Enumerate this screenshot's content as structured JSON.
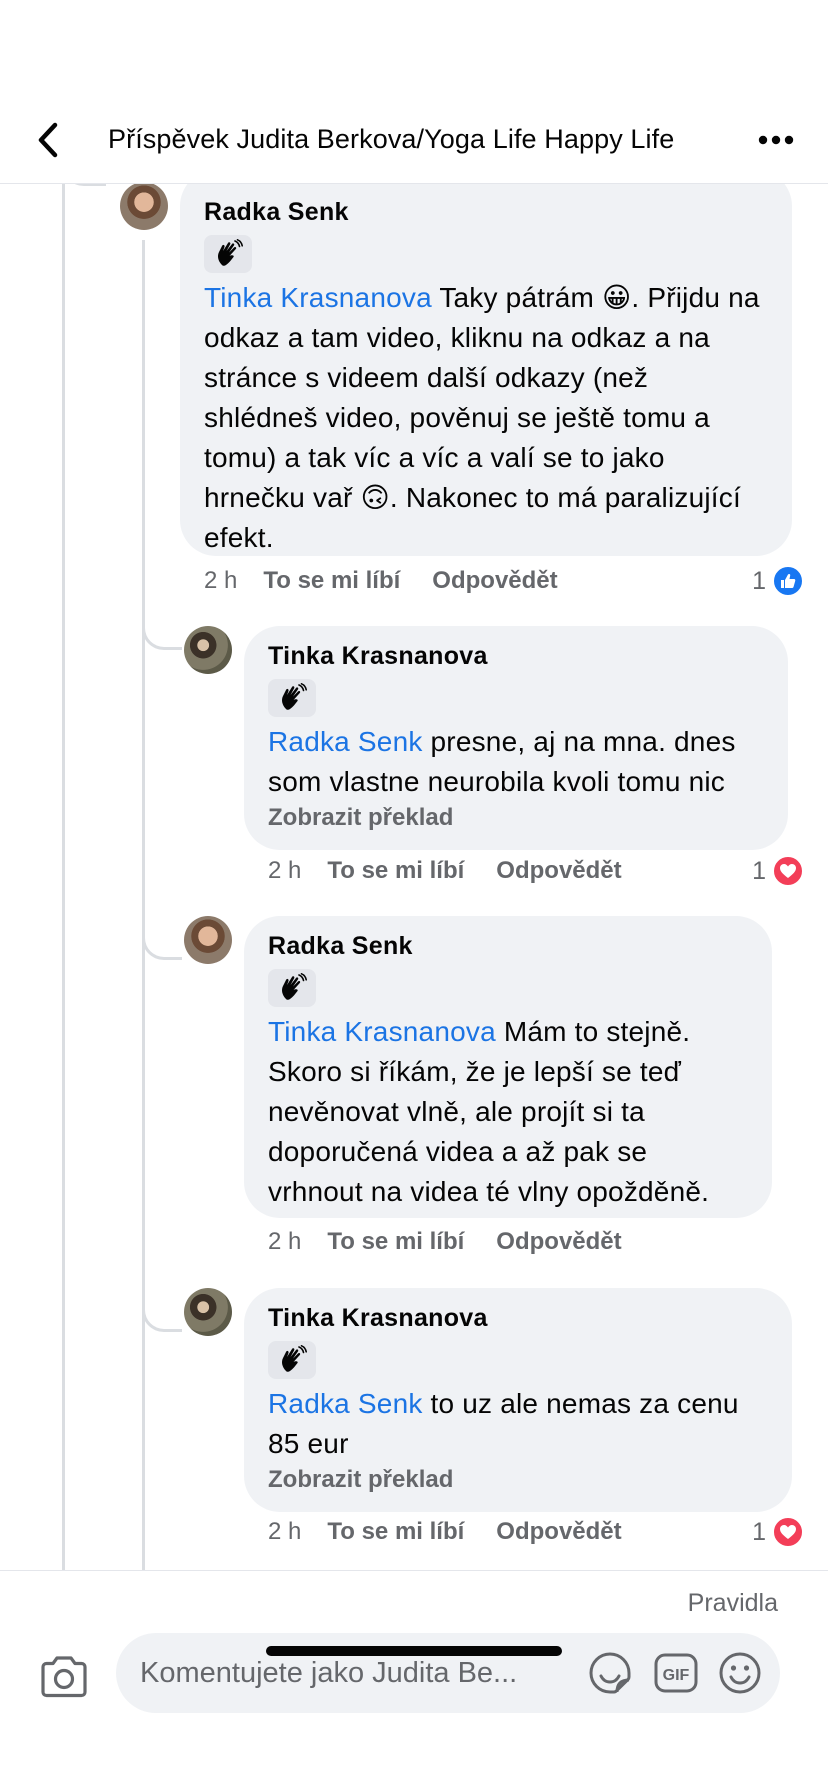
{
  "header": {
    "title": "Příspěvek Judita Berkova/Yoga Life Happy Life",
    "back_icon": "chevron-left-icon",
    "more_icon": "more-dots-icon"
  },
  "comments": [
    {
      "author": "Radka Senk",
      "badge_icon": "wave-hand-icon",
      "mention": "Tinka Krasnanova",
      "text": " Taky pátrám 😀. Přijdu na odkaz a tam video, kliknu na odkaz a na stránce s videem další odkazy (než shlédneš video, pověnuj se ještě tomu a tomu) a tak víc a víc a valí se to jako hrnečku vař 🙃. Nakonec to má paralizující efekt.",
      "time": "2 h",
      "like_label": "To se mi líbí",
      "reply_label": "Odpovědět",
      "reaction_count": "1",
      "reaction_type": "like"
    },
    {
      "author": "Tinka Krasnanova",
      "badge_icon": "wave-hand-icon",
      "mention": "Radka Senk",
      "text": " presne, aj na mna. dnes som vlastne neurobila kvoli tomu nic",
      "translate": "Zobrazit překlad",
      "time": "2 h",
      "like_label": "To se mi líbí",
      "reply_label": "Odpovědět",
      "reaction_count": "1",
      "reaction_type": "love"
    },
    {
      "author": "Radka Senk",
      "badge_icon": "wave-hand-icon",
      "mention": "Tinka Krasnanova",
      "text": " Mám to stejně. Skoro si říkám, že je lepší se teď nevěnovat vlně, ale projít si ta doporučená videa a až pak se vrhnout na videa té vlny opožděně.",
      "time": "2 h",
      "like_label": "To se mi líbí",
      "reply_label": "Odpovědět"
    },
    {
      "author": "Tinka Krasnanova",
      "badge_icon": "wave-hand-icon",
      "mention": "Radka Senk",
      "text": " to uz ale nemas za cenu 85 eur",
      "translate": "Zobrazit překlad",
      "time": "2 h",
      "like_label": "To se mi líbí",
      "reply_label": "Odpovědět",
      "reaction_count": "1",
      "reaction_type": "love"
    }
  ],
  "composer": {
    "rules_label": "Pravidla",
    "placeholder": "Komentujete jako Judita Be...",
    "camera_icon": "camera-icon",
    "sticker_icon": "sticker-icon",
    "gif_label": "GIF",
    "emoji_icon": "emoji-icon"
  },
  "colors": {
    "mention": "#1b74e4",
    "bubble": "#f0f2f5",
    "secondary_text": "#65676b",
    "like": "#1877f2",
    "love": "#f33e58"
  }
}
